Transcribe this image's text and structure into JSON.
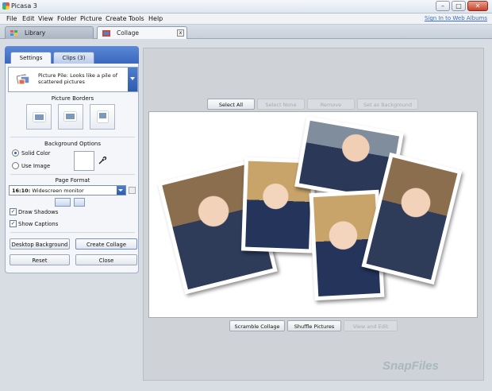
{
  "window": {
    "title": "Picasa 3",
    "min": "–",
    "max": "□",
    "close": "✕"
  },
  "menu": [
    "File",
    "Edit",
    "View",
    "Folder",
    "Picture",
    "Create",
    "Tools",
    "Help"
  ],
  "sign_in": "Sign In to Web Albums",
  "tabs": {
    "library": "Library",
    "collage": "Collage",
    "close": "x"
  },
  "panel": {
    "tabs": {
      "settings": "Settings",
      "clips": "Clips (3)"
    },
    "collage_type": "Picture Pile:  Looks like a pile of scattered pictures",
    "picture_borders": "Picture Borders",
    "background_options": "Background Options",
    "solid_color": "Solid Color",
    "use_image": "Use Image",
    "page_format_label": "Page Format",
    "page_format_ratio": "16:10:",
    "page_format_desc": "Widescreen monitor",
    "draw_shadows": "Draw Shadows",
    "show_captions": "Show Captions",
    "check_mark": "✓",
    "buttons": {
      "desktop_background": "Desktop Background",
      "create_collage": "Create Collage",
      "reset": "Reset",
      "close": "Close"
    }
  },
  "canvas_top_buttons": {
    "select_all": "Select All",
    "select_none": "Select None",
    "remove": "Remove",
    "set_as_background": "Set as Background"
  },
  "canvas_bottom_buttons": {
    "scramble": "Scramble Collage",
    "shuffle": "Shuffle Pictures",
    "view_edit": "View and Edit"
  },
  "watermark": "SnapFiles"
}
